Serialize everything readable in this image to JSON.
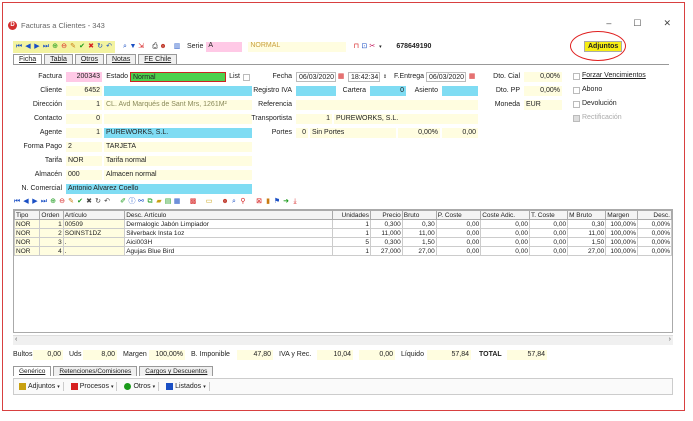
{
  "window": {
    "title": "Facturas a Clientes - 343",
    "app_icon": "D",
    "controls": [
      "–",
      "☐",
      "✕"
    ]
  },
  "toolbar": {
    "serie_label": "Serie",
    "serie_value": "A",
    "serie_type": "NORMAL",
    "phone": "678649190",
    "adjuntos_label": "Adjuntos"
  },
  "top_tabs": [
    "Ficha",
    "Tabla",
    "Otros",
    "Notas",
    "FE Chile"
  ],
  "form": {
    "factura_label": "Factura",
    "factura_value": "200343",
    "estado_label": "Estado",
    "estado_value": "Normal",
    "list_label": "List",
    "cliente_label": "Cliente",
    "cliente_value": "6452",
    "direccion_label": "Dirección",
    "direccion_num": "1",
    "direccion_value": "CL. Avd Marqués de Sant Mrs, 1261M²",
    "contacto_label": "Contacto",
    "contacto_num": "0",
    "agente_label": "Agente",
    "agente_num": "1",
    "agente_value": "PUREWORKS, S.L.",
    "formapago_label": "Forma Pago",
    "formapago_num": "2",
    "formapago_value": "TARJETA",
    "tarifa_label": "Tarifa",
    "tarifa_code": "NOR",
    "tarifa_value": "Tarifa normal",
    "almacen_label": "Almacén",
    "almacen_code": "000",
    "almacen_value": "Almacen normal",
    "ncomercial_label": "N. Comercial",
    "ncomercial_value": "Antonio Alvarez Coello",
    "fecha_label": "Fecha",
    "fecha_value": "06/03/2020",
    "hora_value": "18:42:34",
    "fentrega_label": "F.Entrega",
    "fentrega_value": "06/03/2020",
    "registroiva_label": "Registro IVA",
    "cartera_label": "Cartera",
    "cartera_value": "0",
    "asiento_label": "Asiento",
    "referencia_label": "Referencia",
    "transportista_label": "Transportista",
    "transportista_num": "1",
    "transportista_value": "PUREWORKS, S.L.",
    "portes_label": "Portes",
    "portes_num": "0",
    "portes_value": "Sin Portes",
    "portes_pct": "0,00%",
    "portes_amt": "0,00",
    "dtocial_label": "Dto. Cial",
    "dtocial_value": "0,00%",
    "dtopp_label": "Dto. PP",
    "dtopp_value": "0,00%",
    "moneda_label": "Moneda",
    "moneda_value": "EUR",
    "forzar_label": "Forzar Vencimientos",
    "abono_label": "Abono",
    "devolucion_label": "Devolución",
    "rectificacion_label": "Rectificación"
  },
  "grid": {
    "columns": [
      "Tipo",
      "Orden",
      "Artículo",
      "Desc. Artículo",
      "Unidades",
      "Precio",
      "Bruto",
      "P. Coste",
      "Coste Adic.",
      "T. Coste",
      "M Bruto",
      "Margen",
      "Desc."
    ],
    "rows": [
      [
        "NOR",
        "1",
        "00509",
        "Dermalogic Jabón Limpiador",
        "1",
        "0,300",
        "0,30",
        "0,00",
        "0,00",
        "0,00",
        "0,30",
        "100,00%",
        "0,00%"
      ],
      [
        "NOR",
        "2",
        "SOINST1DZ",
        "Silverback Insta 1oz",
        "1",
        "11,000",
        "11,00",
        "0,00",
        "0,00",
        "0,00",
        "11,00",
        "100,00%",
        "0,00%"
      ],
      [
        "NOR",
        "3",
        ".",
        "Aici003H",
        "5",
        "0,300",
        "1,50",
        "0,00",
        "0,00",
        "0,00",
        "1,50",
        "100,00%",
        "0,00%"
      ],
      [
        "NOR",
        "4",
        ".",
        "Agujas Blue Bird",
        "1",
        "27,000",
        "27,00",
        "0,00",
        "0,00",
        "0,00",
        "27,00",
        "100,00%",
        "0,00%"
      ]
    ]
  },
  "totals": {
    "bultos_label": "Bultos",
    "bultos_value": "0,00",
    "uds_label": "Uds",
    "uds_value": "8,00",
    "margen_label": "Margen",
    "margen_value": "100,00%",
    "bimponible_label": "B. Imponible",
    "bimponible_value": "47,80",
    "ivarec_label": "IVA y Rec.",
    "ivarec_value": "10,04",
    "ivarec_extra": "0,00",
    "liquido_label": "Líquido",
    "liquido_value": "57,84",
    "total_label": "TOTAL",
    "total_value": "57,84"
  },
  "bottom_tabs": [
    "Genérico",
    "Retenciones/Comisiones",
    "Cargos y Descuentos"
  ],
  "bottom_buttons": [
    "Adjuntos",
    "Procesos",
    "Otros",
    "Listados"
  ],
  "colors": {
    "cyan": "#7fdcf3",
    "yellow": "#fffde0",
    "green": "#4dd04d",
    "adjuntos": "#f7ee14",
    "highlight": "#e02020"
  }
}
